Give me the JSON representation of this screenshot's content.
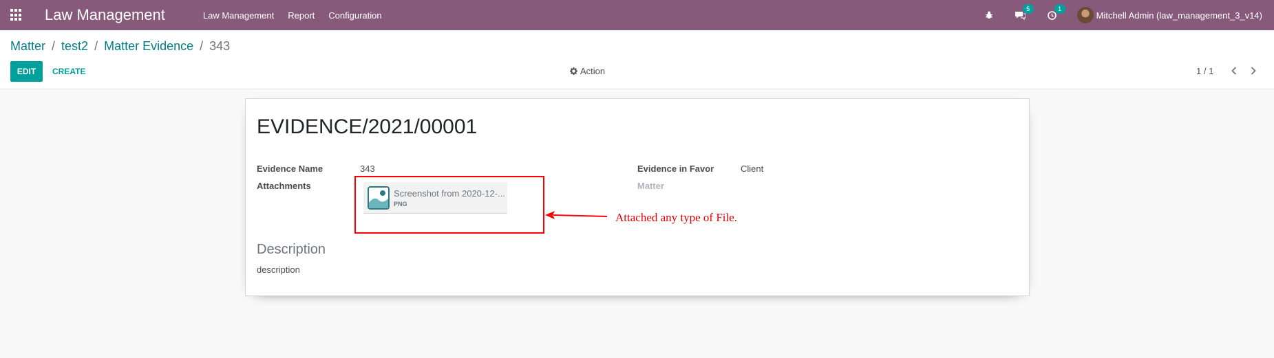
{
  "navbar": {
    "app_name": "Law Management",
    "menu": [
      "Law Management",
      "Report",
      "Configuration"
    ],
    "messages_count": "5",
    "activities_count": "1",
    "user_name": "Mitchell Admin (law_management_3_v14)",
    "icons": [
      "apps-grid-icon",
      "bug-icon",
      "comments-icon",
      "clock-icon"
    ]
  },
  "breadcrumb": {
    "items": [
      "Matter",
      "test2",
      "Matter Evidence"
    ],
    "current": "343"
  },
  "toolbar": {
    "edit_label": "EDIT",
    "create_label": "CREATE",
    "action_label": "Action",
    "pager": "1 / 1"
  },
  "form": {
    "title": "EVIDENCE/2021/00001",
    "evidence_name_label": "Evidence Name",
    "evidence_name_value": "343",
    "attachments_label": "Attachments",
    "attachment": {
      "name": "Screenshot from 2020-12-...",
      "ext": "PNG"
    },
    "evidence_in_favor_label": "Evidence in Favor",
    "evidence_in_favor_value": "Client",
    "matter_label": "Matter",
    "description_title": "Description",
    "description_value": "description"
  },
  "annotation": {
    "text": "Attached any type of File.",
    "color": "#ff0000"
  },
  "colors": {
    "navbar": "#875a7b",
    "primary": "#00a09d",
    "link": "#017e84"
  }
}
